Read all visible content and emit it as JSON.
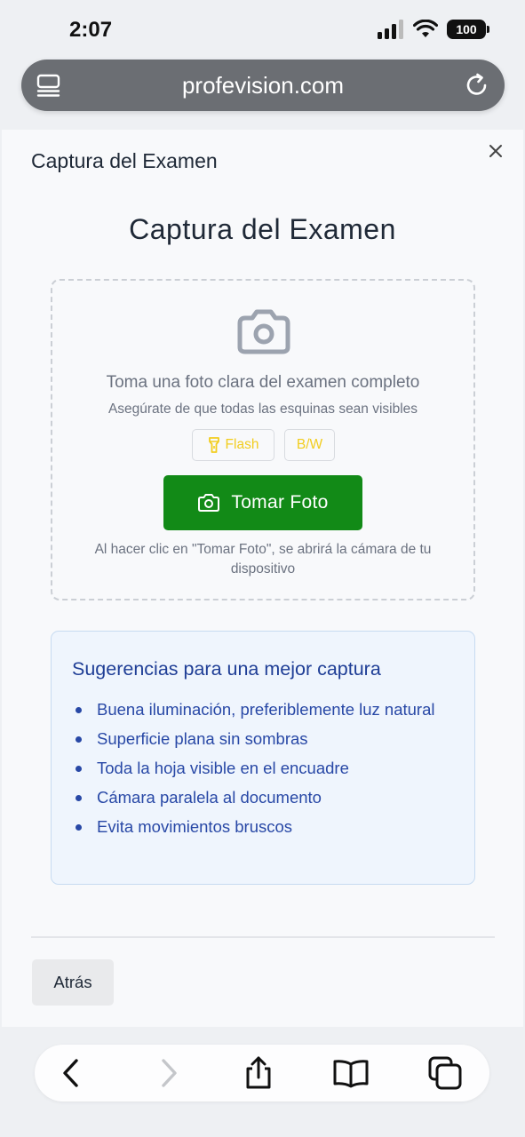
{
  "status": {
    "time": "2:07",
    "battery": "100"
  },
  "browser": {
    "url": "profevision.com"
  },
  "modal": {
    "header_title": "Captura del Examen"
  },
  "main": {
    "title": "Captura del Examen",
    "instruction": "Toma una foto clara del examen completo",
    "sub_instruction": "Asegúrate de que todas las esquinas sean visibles",
    "flash_label": "Flash",
    "bw_label": "B/W",
    "take_photo_label": "Tomar Foto",
    "note": "Al hacer clic en \"Tomar Foto\", se abrirá la cámara de tu dispositivo"
  },
  "tips": {
    "title": "Sugerencias para una mejor captura",
    "items": [
      "Buena iluminación, preferiblemente luz natural",
      "Superficie plana sin sombras",
      "Toda la hoja visible en el encuadre",
      "Cámara paralela al documento",
      "Evita movimientos bruscos"
    ]
  },
  "footer": {
    "back_label": "Atrás"
  },
  "colors": {
    "primary_button": "#128a17",
    "tips_bg": "#eff5fd",
    "tips_text": "#2848a6",
    "option_text": "#f2cd1e"
  },
  "icons": [
    "signal-icon",
    "wifi-icon",
    "battery-icon",
    "tab-list-icon",
    "reload-icon",
    "close-icon",
    "camera-icon",
    "flashlight-icon",
    "back-arrow-icon",
    "forward-arrow-icon",
    "share-icon",
    "bookmarks-icon",
    "tabs-icon"
  ]
}
